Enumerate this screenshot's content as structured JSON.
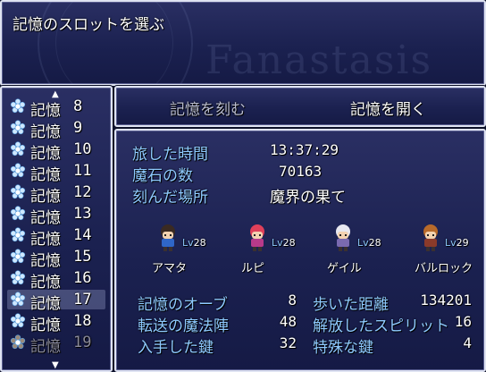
{
  "title": "記憶のスロットを選ぶ",
  "watermark": "Fanastasis",
  "slots": [
    {
      "label": "記憶",
      "num": "8"
    },
    {
      "label": "記憶",
      "num": "9"
    },
    {
      "label": "記憶",
      "num": "10"
    },
    {
      "label": "記憶",
      "num": "11"
    },
    {
      "label": "記憶",
      "num": "12"
    },
    {
      "label": "記憶",
      "num": "13"
    },
    {
      "label": "記憶",
      "num": "14"
    },
    {
      "label": "記憶",
      "num": "15"
    },
    {
      "label": "記憶",
      "num": "16"
    },
    {
      "label": "記憶",
      "num": "17"
    },
    {
      "label": "記憶",
      "num": "18"
    },
    {
      "label": "記憶",
      "num": "19"
    }
  ],
  "selected_slot": "17",
  "commands": {
    "carve": "記憶を刻む",
    "open": "記憶を開く"
  },
  "info": {
    "time_label": "旅した時間",
    "time_value": "13:37:29",
    "stones_label": "魔石の数",
    "stones_value": "70163",
    "place_label": "刻んだ場所",
    "place_value": "魔界の果て"
  },
  "party": [
    {
      "name": "アマタ",
      "lv_label": "Lv",
      "lv": "28",
      "hair": "#3a2a22",
      "cloth": "#2f66c8"
    },
    {
      "name": "ルピ",
      "lv_label": "Lv",
      "lv": "28",
      "hair": "#e0405a",
      "cloth": "#b83a8a"
    },
    {
      "name": "ゲイル",
      "lv_label": "Lv",
      "lv": "28",
      "hair": "#e8e8f0",
      "cloth": "#7a6ab0"
    },
    {
      "name": "バルロック",
      "lv_label": "Lv",
      "lv": "29",
      "hair": "#b86a2a",
      "cloth": "#8a3a2a"
    }
  ],
  "stats_left": [
    {
      "label": "記憶のオーブ",
      "value": "8"
    },
    {
      "label": "転送の魔法陣",
      "value": "48"
    },
    {
      "label": "入手した鍵",
      "value": "32"
    }
  ],
  "stats_right": [
    {
      "label": "歩いた距離",
      "value": "134201"
    },
    {
      "label": "解放したスピリット",
      "value": "16"
    },
    {
      "label": "特殊な鍵",
      "value": "4"
    }
  ],
  "colors": {
    "system": "#8ecaff",
    "window": "#1f2556",
    "border": "#dfe3f2",
    "gem": "#cfe8ff",
    "gem_locked": "#9a8a7a"
  }
}
